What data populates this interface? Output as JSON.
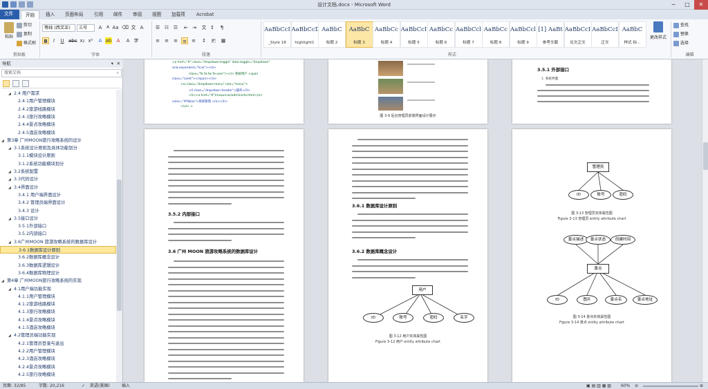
{
  "window": {
    "title": "设计文档.docx - Microsoft Word",
    "minimize": "−",
    "maximize": "□",
    "close": "✕"
  },
  "tabs": [
    "文件",
    "开始",
    "插入",
    "页面布局",
    "引用",
    "邮件",
    "审阅",
    "视图",
    "加载项",
    "Acrobat"
  ],
  "ribbon": {
    "clipboard": {
      "paste": "粘贴",
      "cut": "剪切",
      "copy": "复制",
      "format_painter": "格式刷",
      "label": "剪贴板"
    },
    "font": {
      "name": "等线 (西文正)",
      "size": "三号",
      "label": "字体"
    },
    "paragraph": {
      "label": "段落"
    },
    "styles": {
      "label": "样式",
      "items": [
        {
          "preview": "AaBbCcI",
          "name": "_Style 18"
        },
        {
          "preview": "AaBbCcDd",
          "name": "highlight1"
        },
        {
          "preview": "AaBbC",
          "name": "标题 2"
        },
        {
          "preview": "AaBbC",
          "name": "标题 3"
        },
        {
          "preview": "AaBbCc",
          "name": "标题 4"
        },
        {
          "preview": "AaBbCcI",
          "name": "标题 5"
        },
        {
          "preview": "AaBbCc",
          "name": "标题 6"
        },
        {
          "preview": "AaBbCcl",
          "name": "标题 7"
        },
        {
          "preview": "AaBbCc",
          "name": "标题 8"
        },
        {
          "preview": "AaBbCcl",
          "name": "标题 9"
        },
        {
          "preview": "[1] AaBt",
          "name": "参考文献"
        },
        {
          "preview": "AaBbCcI",
          "name": "论文正文"
        },
        {
          "preview": "AaBbCcI",
          "name": "正文"
        },
        {
          "preview": "AaBbC",
          "name": "样式 标..."
        }
      ],
      "change_styles": "更改样式"
    },
    "editing": {
      "find": "查找",
      "replace": "替换",
      "select": "选择",
      "label": "编辑"
    }
  },
  "nav": {
    "header": "导航",
    "search_placeholder": "搜索文档",
    "items": [
      {
        "text": "2.4 用户需求",
        "level": 2
      },
      {
        "text": "2.4.1用户管理模块",
        "level": 3
      },
      {
        "text": "2.4.2旅游线路模块",
        "level": 3
      },
      {
        "text": "2.4.3旅行攻略模块",
        "level": 3
      },
      {
        "text": "2.4.4景点攻略模块",
        "level": 3
      },
      {
        "text": "2.4.5酒店攻略模块",
        "level": 3
      },
      {
        "text": "第3章 广州MOON旅行攻略系统的设计",
        "level": 1
      },
      {
        "text": "3.1系统设计原则及具体功能划分",
        "level": 2
      },
      {
        "text": "3.1.1模块设计原则",
        "level": 3
      },
      {
        "text": "3.1.2系统功能模块划分",
        "level": 3
      },
      {
        "text": "3.2系统配置",
        "level": 2
      },
      {
        "text": "3.3代码设计",
        "level": 2
      },
      {
        "text": "3.4界面设计",
        "level": 2
      },
      {
        "text": "3.4.1 用户端界面设计",
        "level": 3
      },
      {
        "text": "3.4.2 管理员端界面设计",
        "level": 3
      },
      {
        "text": "3.4.3 设计",
        "level": 3
      },
      {
        "text": "3.5接口设计",
        "level": 2
      },
      {
        "text": "3.5.1外部接口",
        "level": 3
      },
      {
        "text": "3.5.2内部接口",
        "level": 3
      },
      {
        "text": "3.6广州MOON 旅游攻略系统的数据库设计",
        "level": 2
      },
      {
        "text": "3.6.1数据库设计原则",
        "level": 3,
        "selected": true
      },
      {
        "text": "3.6.2数据库概念设计",
        "level": 3
      },
      {
        "text": "3.6.3数据库逻辑设计",
        "level": 3
      },
      {
        "text": "3.6.4数据库物理设计",
        "level": 3
      },
      {
        "text": "第4章 广州MOON旅行攻略系统的实现",
        "level": 1
      },
      {
        "text": "4.1用户端功能实现",
        "level": 2
      },
      {
        "text": "4.1.1用户管理模块",
        "level": 3
      },
      {
        "text": "4.1.2旅游线路模块",
        "level": 3
      },
      {
        "text": "4.1.3旅行攻略模块",
        "level": 3
      },
      {
        "text": "4.1.4景点攻略模块",
        "level": 3
      },
      {
        "text": "4.1.5酒店攻略模块",
        "level": 3
      },
      {
        "text": "4.2管理员端功能实现",
        "level": 2
      },
      {
        "text": "4.2.1管理员登录与退出",
        "level": 3
      },
      {
        "text": "4.2.2用户管理模块",
        "level": 3
      },
      {
        "text": "4.2.3酒店攻略模块",
        "level": 3
      },
      {
        "text": "4.2.4景点攻略模块",
        "level": 3
      },
      {
        "text": "4.2.5旅行攻略模块",
        "level": 3
      }
    ]
  },
  "pages": {
    "p1_code": [
      "<a href=\"#\" class=\"dropdown-toggle\" data-toggle=\"dropdown\"",
      "aria-expanded=\"true\"></a>",
      "class=\"fa fa-fw fa-user\"></i> 系统用户 <span",
      "class=\"caret\"></span></a>",
      "<ul class=\"dropdown-menu\" role=\"menu\">",
      "<li class=\"dropdown-header\">操作</li>",
      "<li><a href=\"#\"/resources/admininfo.html</a>",
      "color=\"#fdbae\">系统管理 </a></li>",
      "</ul> >"
    ],
    "p2_caption": "图 3-9 后台管理员前端界面设计展示",
    "p3_heading": "3.5.1 外部接口",
    "p3_sub": "1. 系统界面",
    "p4_heading1": "3.5.2 内部接口",
    "p4_heading2": "3.6 广州 MOON 旅游攻略系统的数据库设计",
    "p5_heading1": "3.6.1 数据库设计原则",
    "p5_heading2": "3.6.2 数据库概念设计",
    "er_user": {
      "entity": "用户",
      "attrs": [
        "ID",
        "账号",
        "密码",
        "名字"
      ],
      "caption_cn": "图 3-12 用户实体属性图",
      "caption_en": "Figure 3-12 用户  entity attribute chart"
    },
    "er_admin": {
      "entity": "管理员",
      "attrs": [
        "ID",
        "账号",
        "密码"
      ],
      "caption_cn": "图 3-13 管理员实体属性图",
      "caption_en": "Figure 3-13 管理员  entity attribute chart"
    },
    "er_spot": {
      "entity": "景点",
      "attrs": [
        "景点描述",
        "景点状态",
        "创建时间",
        "ID",
        "图片",
        "景点名",
        "景点地址"
      ],
      "caption_cn": "图 3-14 景点实体属性图",
      "caption_en": "Figure 3-14 景点  entity attribute chart"
    }
  },
  "status": {
    "page": "页面: 32/85",
    "words": "字数: 20,216",
    "lang": "英语(美国)",
    "mode": "插入",
    "zoom": "60%"
  },
  "colors": {
    "accent": "#2a5eaa",
    "selected": "#fde89c"
  }
}
